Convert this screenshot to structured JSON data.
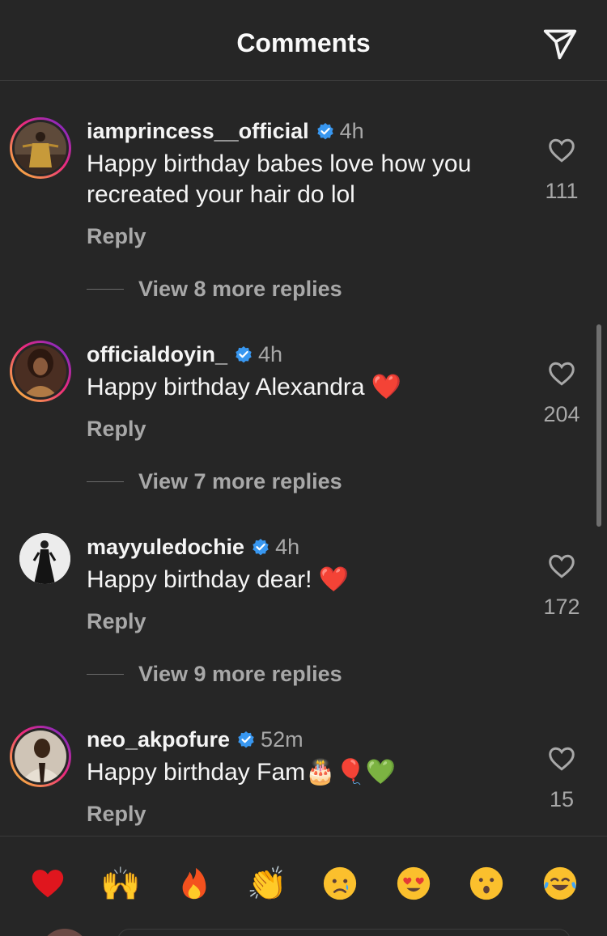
{
  "header": {
    "title": "Comments",
    "share_icon": "paper-plane-icon"
  },
  "comments": [
    {
      "username": "iamprincess__official",
      "verified": true,
      "time": "4h",
      "text": "Happy birthday babes love how you recreated your hair do lol",
      "reply_label": "Reply",
      "view_replies": "View 8 more replies",
      "like_count": "111",
      "avatar_ring": true
    },
    {
      "username": "officialdoyin_",
      "verified": true,
      "time": "4h",
      "text": "Happy birthday Alexandra",
      "text_emoji": "❤️",
      "reply_label": "Reply",
      "view_replies": "View 7 more replies",
      "like_count": "204",
      "avatar_ring": true
    },
    {
      "username": "mayyuledochie",
      "verified": true,
      "time": "4h",
      "text": "Happy birthday dear!",
      "text_emoji": "❤️",
      "reply_label": "Reply",
      "view_replies": "View 9 more replies",
      "like_count": "172",
      "avatar_ring": false
    },
    {
      "username": "neo_akpofure",
      "verified": true,
      "time": "52m",
      "text": "Happy birthday Fam",
      "text_emoji": "🎂🎈💚",
      "reply_label": "Reply",
      "like_count": "15",
      "avatar_ring": true
    }
  ],
  "reactions": [
    "❤️",
    "🙌",
    "🔥",
    "👏",
    "😢",
    "😍",
    "😮",
    "😂"
  ],
  "colors": {
    "background": "#262626",
    "text_primary": "#f5f5f5",
    "text_secondary": "#a8a8a8",
    "verified_blue": "#3897f0"
  }
}
